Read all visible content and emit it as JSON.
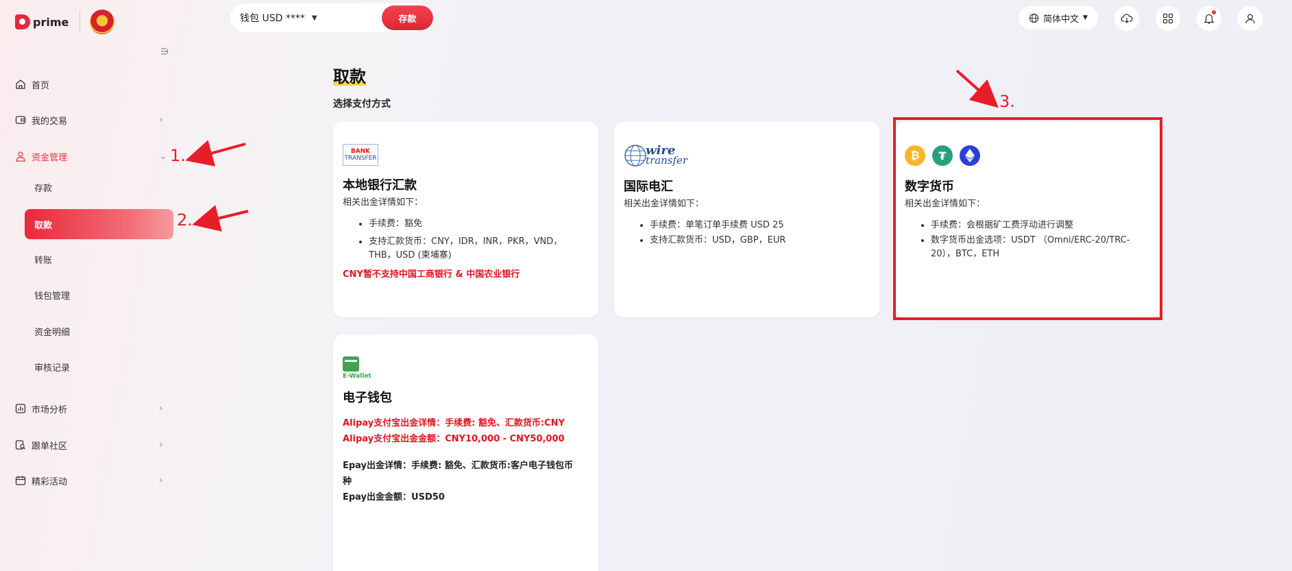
{
  "brand": {
    "name": "prime"
  },
  "header": {
    "wallet_label": "钱包 USD ****",
    "deposit_button": "存款",
    "language": "简体中文"
  },
  "sidebar": {
    "home": "首页",
    "my_trades": "我的交易",
    "fund_management": "资金管理",
    "sub_items": {
      "deposit": "存款",
      "withdraw": "取款",
      "transfer": "转账",
      "wallet_management": "钱包管理",
      "fund_details": "资金明细",
      "review_records": "审核记录"
    },
    "market_analysis": "市场分析",
    "copy_community": "跟单社区",
    "events": "精彩活动"
  },
  "main": {
    "title": "取款",
    "subtitle": "选择支付方式",
    "cards": {
      "local_bank": {
        "logo_line1": "BANK",
        "logo_line2": "TRANSFER",
        "title": "本地银行汇款",
        "desc": "相关出金详情如下：",
        "bullets": [
          "手续费：豁免",
          "支持汇款货币：CNY，IDR，INR，PKR，VND，THB，USD (柬埔寨)"
        ],
        "warning": "CNY暂不支持中国工商银行 & 中国农业银行"
      },
      "wire": {
        "logo_text1": "wire",
        "logo_text2": "transfer",
        "title": "国际电汇",
        "desc": "相关出金详情如下：",
        "bullets": [
          "手续费：单笔订单手续费 USD 25",
          "支持汇款货币：USD，GBP，EUR"
        ]
      },
      "crypto": {
        "title": "数字货币",
        "desc": "相关出金详情如下：",
        "bullets": [
          "手续费：会根据矿工费浮动进行调整",
          "数字货币出金选项：USDT （Omni/ERC-20/TRC-20），BTC，ETH"
        ]
      },
      "ewallet": {
        "logo_text": "E-Wallet",
        "title": "电子钱包",
        "alipay_line1": "Alipay支付宝出金详情：手续费: 豁免、汇款货币:CNY",
        "alipay_line2": "Alipay支付宝出金金额：CNY10,000 - CNY50,000",
        "epay_line1": "Epay出金详情：手续费: 豁免、汇款货币:客户电子钱包币种",
        "epay_line2": "Epay出金金额：USD50"
      }
    }
  },
  "annotations": {
    "a1": "1.",
    "a2": "2.",
    "a3": "3."
  },
  "colors": {
    "accent": "#e8333f",
    "highlight": "#e81d2a",
    "warning_text": "#e0141e"
  }
}
